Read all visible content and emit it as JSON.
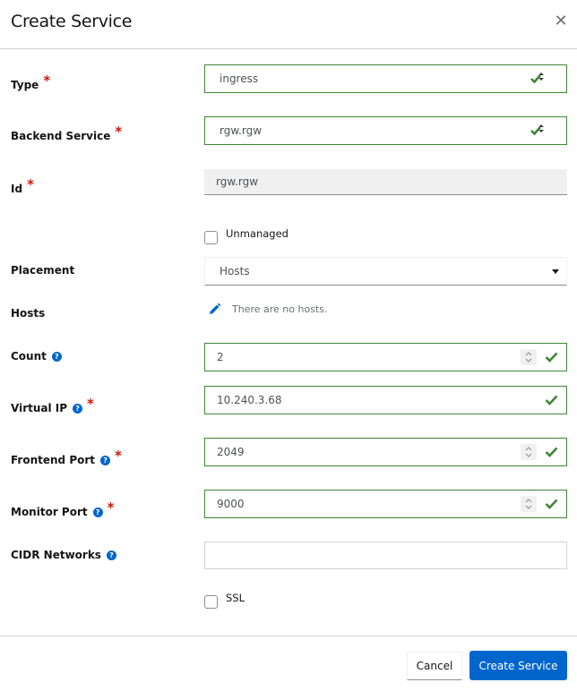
{
  "dialog": {
    "title": "Create Service",
    "close_icon": "close-icon"
  },
  "colors": {
    "primary": "#0066cc",
    "success": "#3e8635",
    "required": "#c9190b",
    "help": "#0066cc"
  },
  "form": {
    "type": {
      "label": "Type",
      "required": true,
      "value": "ingress"
    },
    "backend_service": {
      "label": "Backend Service",
      "required": true,
      "value": "rgw.rgw"
    },
    "id": {
      "label": "Id",
      "required": true,
      "value": "rgw.rgw"
    },
    "unmanaged": {
      "label": "Unmanaged",
      "checked": false
    },
    "placement": {
      "label": "Placement",
      "value": "Hosts"
    },
    "hosts": {
      "label": "Hosts",
      "empty_text": "There are no hosts."
    },
    "count": {
      "label": "Count",
      "value": "2",
      "help": true
    },
    "virtual_ip": {
      "label": "Virtual IP",
      "required": true,
      "value": "10.240.3.68",
      "help": true
    },
    "frontend_port": {
      "label": "Frontend Port",
      "required": true,
      "value": "2049",
      "help": true
    },
    "monitor_port": {
      "label": "Monitor Port",
      "required": true,
      "value": "9000",
      "help": true
    },
    "cidr_networks": {
      "label": "CIDR Networks",
      "value": "",
      "help": true
    },
    "ssl": {
      "label": "SSL",
      "checked": false
    },
    "required_marker": "*",
    "help_glyph": "?"
  },
  "footer": {
    "cancel_label": "Cancel",
    "submit_label": "Create Service"
  }
}
